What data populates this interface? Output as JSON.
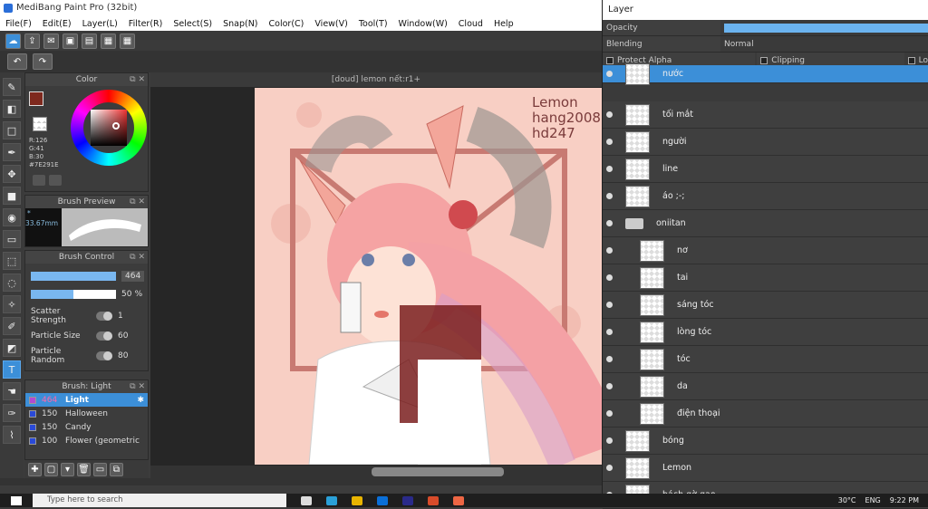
{
  "window": {
    "title": "MediBang Paint Pro (32bit)"
  },
  "menu": [
    "File(F)",
    "Edit(E)",
    "Layer(L)",
    "Filter(R)",
    "Select(S)",
    "Snap(N)",
    "Color(C)",
    "View(V)",
    "Tool(T)",
    "Window(W)",
    "Cloud",
    "Help"
  ],
  "panels": {
    "color": {
      "title": "Color",
      "r": "R:126",
      "g": "G:41",
      "b": "B:30",
      "hex": "#7E291E",
      "primary_color": "#7e291e"
    },
    "brush_preview": {
      "title": "Brush Preview",
      "size": "* 33.67mm"
    },
    "brush_control": {
      "title": "Brush Control",
      "size_value": "464",
      "opacity_value": "50",
      "opacity_unit": "%",
      "scatter_label": "Scatter Strength",
      "scatter_value": "1",
      "particle_size_label": "Particle Size",
      "particle_size_value": "60",
      "particle_random_label": "Particle Random",
      "particle_random_value": "80"
    },
    "brush_list": {
      "title": "Brush: Light",
      "items": [
        {
          "size": "464",
          "name": "Light",
          "color": "#b44bd0"
        },
        {
          "size": "150",
          "name": "Halloween",
          "color": "#2a4ad8"
        },
        {
          "size": "150",
          "name": "Candy",
          "color": "#2a4ad8"
        },
        {
          "size": "100",
          "name": "Flower (geometric",
          "color": "#2a4ad8"
        }
      ]
    }
  },
  "canvas": {
    "tab_title": "[doud] lemon nết:r1+",
    "watermark_line1": "Lemon",
    "watermark_line2": "hang2008",
    "watermark_line3": "hd247"
  },
  "layer_panel": {
    "title": "Layer",
    "opacity_label": "Opacity",
    "blending_label": "Blending",
    "blending_value": "Normal",
    "protect_alpha_label": "Protect Alpha",
    "clipping_label": "Clipping",
    "lock_label": "Lo",
    "layers": [
      {
        "name": "nước",
        "selected": true
      },
      {
        "name": "tối mắt"
      },
      {
        "name": "người"
      },
      {
        "name": "line"
      },
      {
        "name": "áo ;-;"
      },
      {
        "name": "oniitan",
        "folder": true
      },
      {
        "name": "nơ",
        "child": true
      },
      {
        "name": "tai",
        "child": true
      },
      {
        "name": "sáng tóc",
        "child": true
      },
      {
        "name": "lòng tóc",
        "child": true
      },
      {
        "name": "tóc",
        "child": true
      },
      {
        "name": "da",
        "child": true
      },
      {
        "name": "điện thoại",
        "child": true
      },
      {
        "name": "bóng"
      },
      {
        "name": "Lemon"
      },
      {
        "name": "bách gờ gao"
      }
    ]
  },
  "taskbar": {
    "search_placeholder": "Type here to search",
    "time": "9:22 PM",
    "lang": "ENG",
    "weather": "30°C"
  }
}
